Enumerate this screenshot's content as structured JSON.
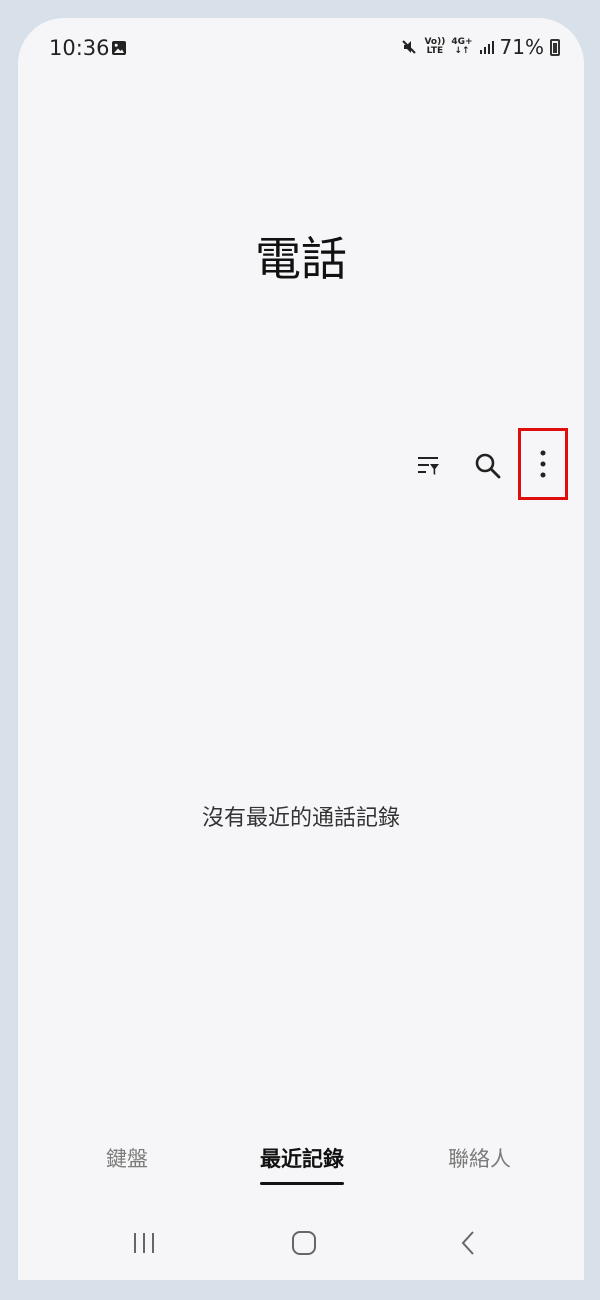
{
  "status_bar": {
    "time": "10:36",
    "battery": "71%",
    "volte": "Vo))\nLTE",
    "network": "4G+\n↓↑",
    "icons": [
      "gallery-icon",
      "mute-icon",
      "volte-icon",
      "network-4g-icon",
      "signal-icon",
      "battery-icon"
    ]
  },
  "app": {
    "title": "電話"
  },
  "toolbar": {
    "filter_icon": "filter-icon",
    "search_icon": "search-icon",
    "more_icon": "more-options-icon"
  },
  "main": {
    "empty_message": "沒有最近的通話記錄"
  },
  "tabs": [
    {
      "label": "鍵盤",
      "selected": false
    },
    {
      "label": "最近記錄",
      "selected": true
    },
    {
      "label": "聯絡人",
      "selected": false
    }
  ],
  "highlight_color": "#e00d0d"
}
